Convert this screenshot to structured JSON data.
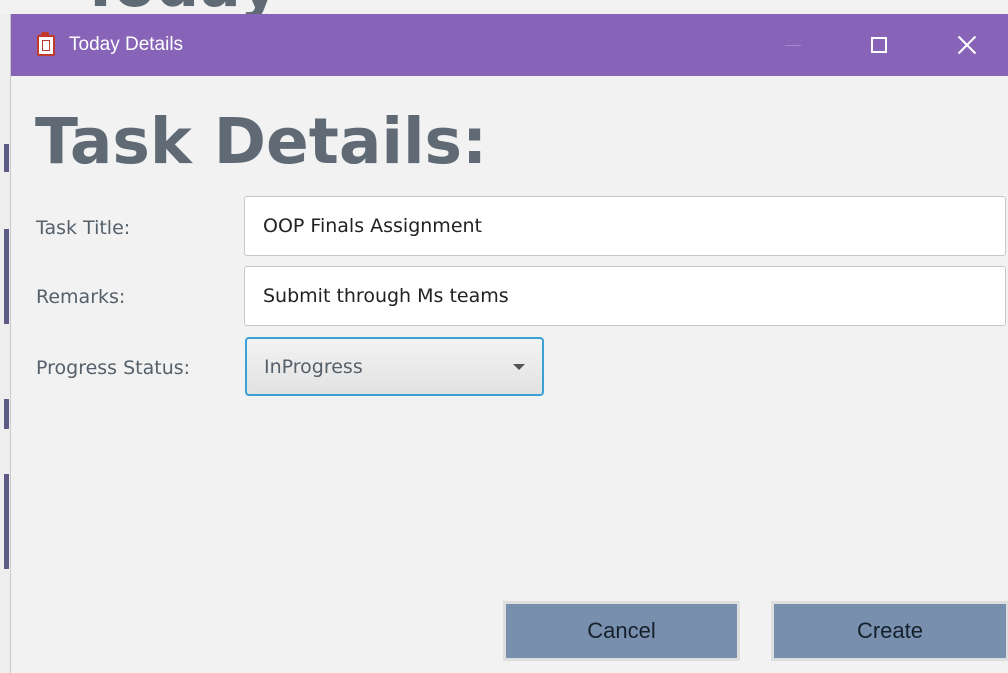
{
  "background_window": {
    "heading_partial": "Today"
  },
  "window": {
    "title": "Today Details",
    "app_icon": "clipboard-icon",
    "controls": {
      "minimize_icon": "minimize-icon",
      "maximize_icon": "maximize-icon",
      "close_icon": "close-icon"
    },
    "titlebar_color": "#8764b8"
  },
  "form": {
    "heading": "Task Details:",
    "task_title": {
      "label": "Task Title:",
      "value": "OOP Finals Assignment"
    },
    "remarks": {
      "label": "Remarks:",
      "value": "Submit through Ms teams"
    },
    "progress_status": {
      "label": "Progress Status:",
      "selected": "InProgress"
    }
  },
  "actions": {
    "cancel_label": "Cancel",
    "create_label": "Create",
    "button_color": "#7890ae"
  }
}
